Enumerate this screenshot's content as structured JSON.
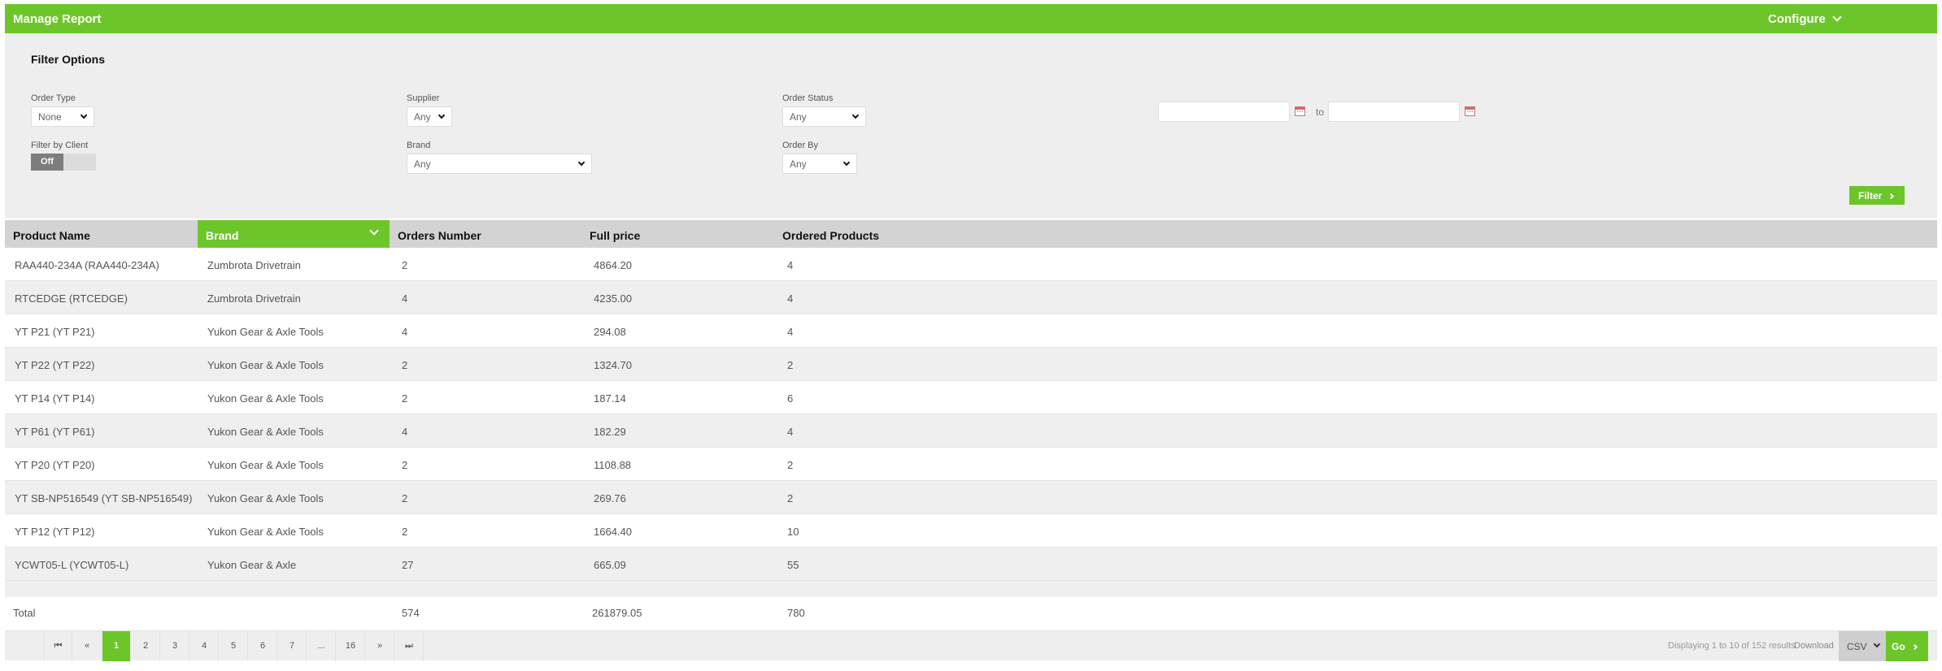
{
  "header": {
    "title": "Manage Report",
    "configure_label": "Configure"
  },
  "filters": {
    "title": "Filter Options",
    "order_type": {
      "label": "Order Type",
      "value": "None"
    },
    "supplier": {
      "label": "Supplier",
      "value": "Any"
    },
    "order_status": {
      "label": "Order Status",
      "value": "Any"
    },
    "date_to_label": "to",
    "filter_by_client": {
      "label": "Filter by Client",
      "value": "Off"
    },
    "brand": {
      "label": "Brand",
      "value": "Any"
    },
    "order_by": {
      "label": "Order By",
      "value": "Any"
    },
    "filter_button": "Filter"
  },
  "table": {
    "columns": [
      "Product Name",
      "Brand",
      "Orders Number",
      "Full price",
      "Ordered Products"
    ],
    "rows": [
      [
        "RAA440-234A (RAA440-234A)",
        "Zumbrota Drivetrain",
        "2",
        "4864.20",
        "4"
      ],
      [
        "RTCEDGE (RTCEDGE)",
        "Zumbrota Drivetrain",
        "4",
        "4235.00",
        "4"
      ],
      [
        "YT P21 (YT P21)",
        "Yukon Gear & Axle Tools",
        "4",
        "294.08",
        "4"
      ],
      [
        "YT P22 (YT P22)",
        "Yukon Gear & Axle Tools",
        "2",
        "1324.70",
        "2"
      ],
      [
        "YT P14 (YT P14)",
        "Yukon Gear & Axle Tools",
        "2",
        "187.14",
        "6"
      ],
      [
        "YT P61 (YT P61)",
        "Yukon Gear & Axle Tools",
        "4",
        "182.29",
        "4"
      ],
      [
        "YT P20 (YT P20)",
        "Yukon Gear & Axle Tools",
        "2",
        "1108.88",
        "2"
      ],
      [
        "YT SB-NP516549 (YT SB-NP516549)",
        "Yukon Gear & Axle Tools",
        "2",
        "269.76",
        "2"
      ],
      [
        "YT P12 (YT P12)",
        "Yukon Gear & Axle Tools",
        "2",
        "1664.40",
        "10"
      ],
      [
        "YCWT05-L (YCWT05-L)",
        "Yukon Gear & Axle",
        "27",
        "665.09",
        "55"
      ]
    ],
    "total": {
      "label": "Total",
      "orders": "574",
      "price": "261879.05",
      "products": "780"
    }
  },
  "pagination": {
    "first": "⏮",
    "prev": "«",
    "pages": [
      "1",
      "2",
      "3",
      "4",
      "5",
      "6",
      "7",
      "...",
      "16"
    ],
    "active_page": "1",
    "next": "»",
    "last": "⏭",
    "displaying": "Displaying 1 to 10 of 152 results",
    "download_label": "Download",
    "format": "CSV",
    "go_label": "Go"
  },
  "colors": {
    "accent": "#6cc62a",
    "header_row": "#d3d3d3",
    "filter_bg": "#eeeeee"
  },
  "icons": {
    "calendar": "calendar-icon",
    "chevron": "chevron-down-icon"
  }
}
